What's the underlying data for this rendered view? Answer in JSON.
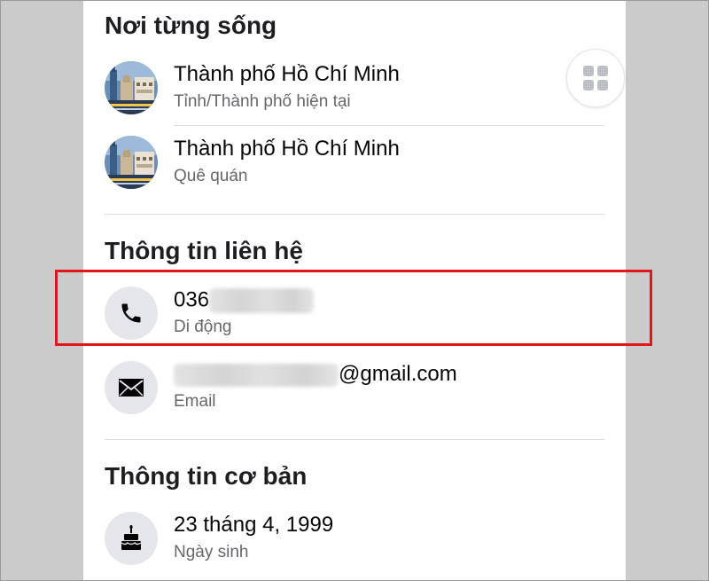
{
  "sections": {
    "lived": {
      "title": "Nơi từng sống",
      "items": [
        {
          "primary": "Thành phố Hồ Chí Minh",
          "secondary": "Tỉnh/Thành phố hiện tại",
          "icon": "city-photo-avatar"
        },
        {
          "primary": "Thành phố Hồ Chí Minh",
          "secondary": "Quê quán",
          "icon": "city-photo-avatar"
        }
      ]
    },
    "contact": {
      "title": "Thông tin liên hệ",
      "phone": {
        "visible_prefix": "036",
        "secondary": "Di động",
        "icon": "phone-icon"
      },
      "email": {
        "visible_suffix": "@gmail.com",
        "secondary": "Email",
        "icon": "envelope-icon"
      }
    },
    "basic": {
      "title": "Thông tin cơ bản",
      "birthday": {
        "primary": "23 tháng 4, 1999",
        "secondary": "Ngày sinh",
        "icon": "birthday-cake-icon"
      }
    }
  },
  "floating": {
    "icon": "grid-icon"
  },
  "colors": {
    "highlight": "#e0161b",
    "icon_bg": "#e4e6eb",
    "secondary_text": "#65676b",
    "page_background": "#cbcbcb"
  }
}
